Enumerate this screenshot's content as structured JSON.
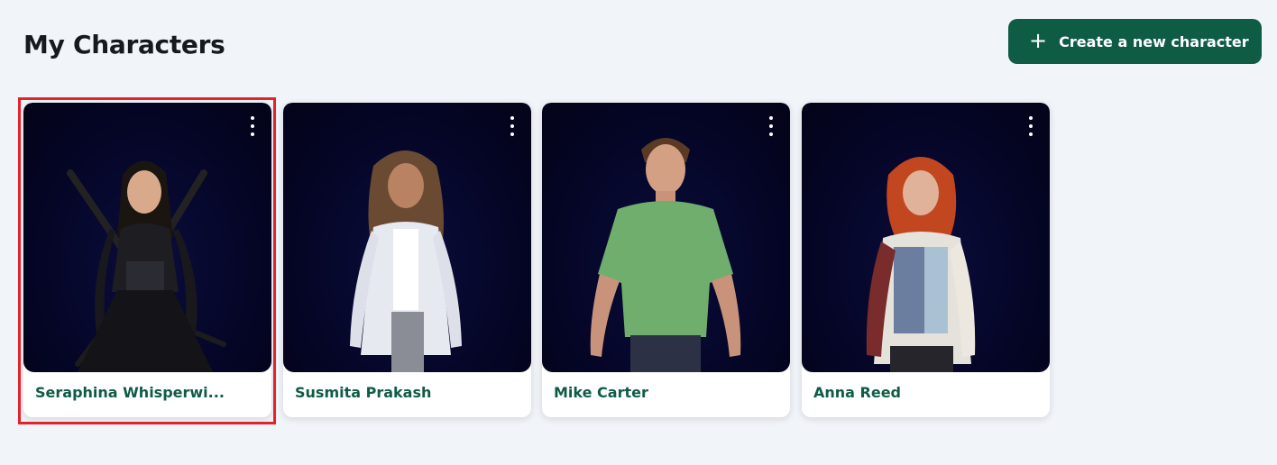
{
  "header": {
    "title": "My Characters",
    "create_button": {
      "label": "Create a new character",
      "icon": "plus-icon"
    }
  },
  "characters": [
    {
      "name": "Seraphina Whisperwi...",
      "selected": true
    },
    {
      "name": "Susmita Prakash",
      "selected": false
    },
    {
      "name": "Mike Carter",
      "selected": false
    },
    {
      "name": "Anna Reed",
      "selected": false
    }
  ],
  "card_menu_icon": "more-vertical-icon",
  "colors": {
    "page_background": "#f1f4f8",
    "accent": "#0f5c45",
    "thumbnail_background": "#050628",
    "selection_outline": "#e3232c"
  }
}
